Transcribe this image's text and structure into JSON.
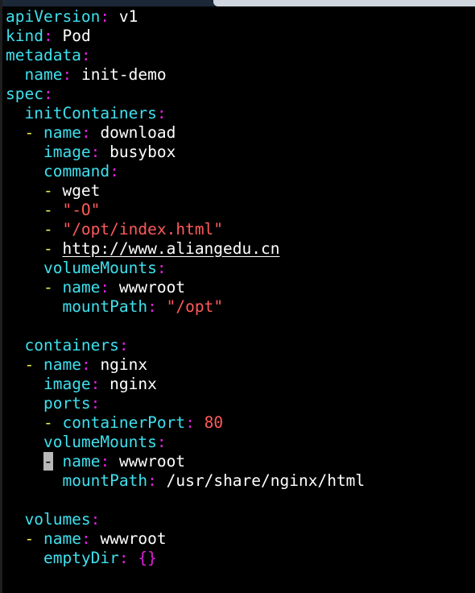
{
  "lines": [
    {
      "indent": "",
      "key": "apiVersion",
      "value": "v1",
      "vtype": "val"
    },
    {
      "indent": "",
      "key": "kind",
      "value": "Pod",
      "vtype": "val"
    },
    {
      "indent": "",
      "key": "metadata",
      "value": "",
      "vtype": "val"
    },
    {
      "indent": "  ",
      "key": "name",
      "value": "init-demo",
      "vtype": "val"
    },
    {
      "indent": "",
      "key": "spec",
      "value": "",
      "vtype": "val"
    },
    {
      "indent": "  ",
      "key": "initContainers",
      "value": "",
      "vtype": "val"
    },
    {
      "indent": "  ",
      "dash": "- ",
      "key": "name",
      "value": "download",
      "vtype": "val"
    },
    {
      "indent": "    ",
      "key": "image",
      "value": "busybox",
      "vtype": "val"
    },
    {
      "indent": "    ",
      "key": "command",
      "value": "",
      "vtype": "val"
    },
    {
      "indent": "    ",
      "dash": "- ",
      "item": "wget",
      "vtype": "val"
    },
    {
      "indent": "    ",
      "dash": "- ",
      "item": "\"-O\"",
      "vtype": "str"
    },
    {
      "indent": "    ",
      "dash": "- ",
      "item": "\"/opt/index.html\"",
      "vtype": "str"
    },
    {
      "indent": "    ",
      "dash": "- ",
      "item": "http://www.aliangedu.cn",
      "vtype": "url"
    },
    {
      "indent": "    ",
      "key": "volumeMounts",
      "value": "",
      "vtype": "val"
    },
    {
      "indent": "    ",
      "dash": "- ",
      "key": "name",
      "value": "wwwroot",
      "vtype": "val"
    },
    {
      "indent": "      ",
      "key": "mountPath",
      "value": "\"/opt\"",
      "vtype": "str"
    },
    {
      "blank": true
    },
    {
      "indent": "  ",
      "key": "containers",
      "value": "",
      "vtype": "val"
    },
    {
      "indent": "  ",
      "dash": "- ",
      "key": "name",
      "value": "nginx",
      "vtype": "val"
    },
    {
      "indent": "    ",
      "key": "image",
      "value": "nginx",
      "vtype": "val"
    },
    {
      "indent": "    ",
      "key": "ports",
      "value": "",
      "vtype": "val"
    },
    {
      "indent": "    ",
      "dash": "- ",
      "key": "containerPort",
      "value": "80",
      "vtype": "num"
    },
    {
      "indent": "    ",
      "key": "volumeMounts",
      "value": "",
      "vtype": "val"
    },
    {
      "indent": "    ",
      "dash": "- ",
      "cursor": true,
      "key": "name",
      "value": "wwwroot",
      "vtype": "val"
    },
    {
      "indent": "      ",
      "key": "mountPath",
      "value": "/usr/share/nginx/html",
      "vtype": "val"
    },
    {
      "blank": true
    },
    {
      "indent": "  ",
      "key": "volumes",
      "value": "",
      "vtype": "val"
    },
    {
      "indent": "  ",
      "dash": "- ",
      "key": "name",
      "value": "wwwroot",
      "vtype": "val"
    },
    {
      "indent": "    ",
      "key": "emptyDir",
      "value": "{}",
      "vtype": "brace"
    }
  ],
  "colors": {
    "background": "#000000",
    "key": "#3fe0ee",
    "colon": "#e01ee0",
    "dash": "#f0ef50",
    "string": "#ff5a5a",
    "value": "#ffffff"
  }
}
